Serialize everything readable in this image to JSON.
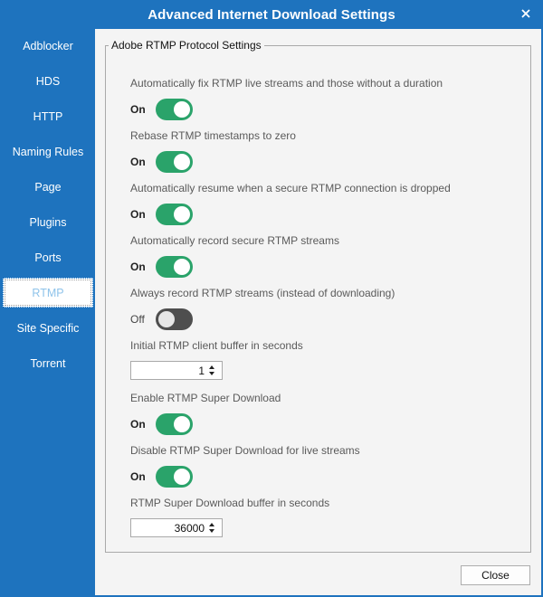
{
  "window": {
    "title": "Advanced Internet Download Settings"
  },
  "sidebar": {
    "items": [
      {
        "label": "Adblocker"
      },
      {
        "label": "HDS"
      },
      {
        "label": "HTTP"
      },
      {
        "label": "Naming Rules"
      },
      {
        "label": "Page"
      },
      {
        "label": "Plugins"
      },
      {
        "label": "Ports"
      },
      {
        "label": "RTMP",
        "selected": true
      },
      {
        "label": "Site Specific"
      },
      {
        "label": "Torrent"
      }
    ]
  },
  "group": {
    "legend": "Adobe RTMP Protocol Settings",
    "settings": [
      {
        "label": "Automatically fix RTMP live streams and those without a duration",
        "state": "On"
      },
      {
        "label": "Rebase RTMP timestamps to zero",
        "state": "On"
      },
      {
        "label": "Automatically resume when a secure RTMP connection is dropped",
        "state": "On"
      },
      {
        "label": "Automatically record secure RTMP streams",
        "state": "On"
      },
      {
        "label": "Always record RTMP streams (instead of downloading)",
        "state": "Off"
      },
      {
        "label": "Initial RTMP client buffer in seconds",
        "value": "1"
      },
      {
        "label": "Enable RTMP Super Download",
        "state": "On"
      },
      {
        "label": "Disable RTMP Super Download for live streams",
        "state": "On"
      },
      {
        "label": "RTMP Super Download buffer in seconds",
        "value": "36000"
      }
    ]
  },
  "footer": {
    "close_label": "Close"
  },
  "colors": {
    "accent": "#1e73be",
    "toggle_on": "#2aa36a",
    "toggle_off": "#4e4e4e"
  }
}
